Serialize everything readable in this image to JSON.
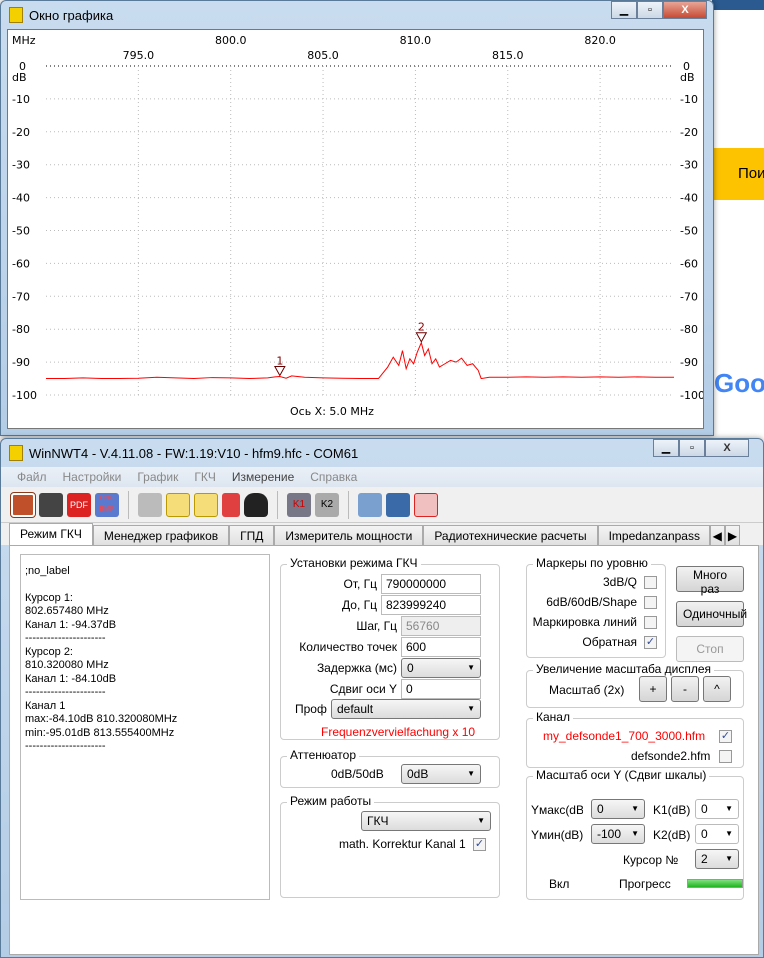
{
  "background": {
    "yellow_text": "Пои",
    "logo_text": "Goo"
  },
  "graph_window": {
    "title": "Окно графика",
    "x_unit": "MHz",
    "y_unit": "dB",
    "x_axis_label": "Ось X: 5.0 MHz",
    "chart_data": {
      "type": "line",
      "xlabel": "Ось X: 5.0 MHz",
      "ylabel": "dB",
      "xlim": [
        790,
        824
      ],
      "ylim": [
        -100,
        0
      ],
      "x_ticks_top": [
        "800.0",
        "810.0",
        "820.0"
      ],
      "x_ticks_bottom": [
        "795.0",
        "805.0",
        "815.0"
      ],
      "x_tick_values_top": [
        800,
        810,
        820
      ],
      "x_tick_values_bottom": [
        795,
        805,
        815
      ],
      "y_ticks": [
        "0",
        "-10",
        "-20",
        "-30",
        "-40",
        "-50",
        "-60",
        "-70",
        "-80",
        "-90",
        "-100"
      ],
      "y_tick_values": [
        0,
        -10,
        -20,
        -30,
        -40,
        -50,
        -60,
        -70,
        -80,
        -90,
        -100
      ],
      "grid": true,
      "series": [
        {
          "name": "Канал 1",
          "color": "#ff0000",
          "x": [
            790,
            791,
            792,
            793,
            794,
            795,
            796,
            797,
            798,
            799,
            800,
            801,
            802,
            802.4,
            802.66,
            803,
            803.3,
            804,
            805,
            806,
            807,
            808,
            808.5,
            808.8,
            809.1,
            809.3,
            809.5,
            809.7,
            809.9,
            810.1,
            810.32,
            810.5,
            810.7,
            810.9,
            811.1,
            811.3,
            811.6,
            811.9,
            812.2,
            812.5,
            812.8,
            813.1,
            813.4,
            813.56,
            814,
            815,
            816,
            817,
            818,
            819,
            820,
            821,
            822,
            823,
            824
          ],
          "y": [
            -95,
            -95,
            -94.8,
            -95,
            -95,
            -94.9,
            -94.6,
            -94.8,
            -95,
            -94.7,
            -94.8,
            -95,
            -94.8,
            -94.5,
            -94.37,
            -94.9,
            -94.2,
            -94.6,
            -94.8,
            -94.9,
            -95,
            -95,
            -91.5,
            -88.5,
            -91,
            -86.5,
            -92,
            -89,
            -90.5,
            -87,
            -84.1,
            -88,
            -86,
            -90.5,
            -89,
            -91.5,
            -90.5,
            -89.5,
            -90,
            -88.8,
            -91,
            -90.5,
            -92.5,
            -95.01,
            -94.6,
            -94.6,
            -94.5,
            -94.6,
            -94.5,
            -94.6,
            -94.5,
            -94.6,
            -94.5,
            -94.6,
            -94.6
          ]
        }
      ],
      "markers": [
        {
          "label": "1",
          "x": 802.66,
          "y": -94.37
        },
        {
          "label": "2",
          "x": 810.32,
          "y": -84.1
        }
      ]
    }
  },
  "main_window": {
    "title": "WinNWT4 - V.4.11.08 - FW:1.19:V10 - hfm9.hfc - COM61",
    "menu": [
      "Файл",
      "Настройки",
      "График",
      "ГКЧ",
      "Измерение",
      "Справка"
    ],
    "tabs": [
      "Режим ГКЧ",
      "Менеджер графиков",
      "ГПД",
      "Измеритель мощности",
      "Радиотехнические расчеты",
      "Impedanzanpass"
    ],
    "info_lines": [
      ";no_label",
      "",
      "Курсор 1:",
      "802.657480 MHz",
      "Канал 1:  -94.37dB",
      "----------------------",
      "Курсор 2:",
      "810.320080 MHz",
      "Канал 1:  -84.10dB",
      "----------------------",
      "Канал 1",
      "max:-84.10dB 810.320080MHz",
      "min:-95.01dB 813.555400MHz",
      "----------------------"
    ],
    "sweep": {
      "title": "Установки режима ГКЧ",
      "from_label": "От, Гц",
      "from": "790000000",
      "to_label": "До, Гц",
      "to": "823999240",
      "step_label": "Шаг, Гц",
      "step": "56760",
      "points_label": "Количество точек",
      "points": "600",
      "delay_label": "Задержка (мс)",
      "delay": "0",
      "yshift_label": "Сдвиг оси Y",
      "yshift": "0",
      "profile_label": "Проф",
      "profile": "default",
      "note": "Frequenzvervielfachung x 10",
      "note_color": "#ff0000"
    },
    "attenuator": {
      "title": "Аттенюатор",
      "label": "0dB/50dB",
      "value": "0dB"
    },
    "mode": {
      "title": "Режим работы",
      "value": "ГКЧ",
      "korr_label": "math. Korrektur Kanal 1",
      "korr_checked": true
    },
    "markers": {
      "title": "Маркеры по уровню",
      "items": [
        {
          "label": "3dB/Q",
          "checked": false
        },
        {
          "label": "6dB/60dB/Shape",
          "checked": false
        },
        {
          "label": "Маркировка линий",
          "checked": false
        },
        {
          "label": "Обратная",
          "checked": true
        }
      ]
    },
    "buttons": {
      "multi": "Много раз",
      "single": "Одиночный",
      "stop": "Стоп"
    },
    "zoom": {
      "title": "Увеличение масштаба дисплея",
      "label": "Масштаб (2x)",
      "plus": "+",
      "minus": "-",
      "up": "^"
    },
    "channel": {
      "title": "Канал",
      "file1": "my_defsonde1_700_3000.hfm",
      "file1_checked": true,
      "file2": "defsonde2.hfm",
      "file2_checked": false
    },
    "yscale": {
      "title": "Масштаб оси Y (Сдвиг шкалы)",
      "ymax_label": "Yмакс(dB",
      "ymax": "0",
      "ymin_label": "Yмин(dB)",
      "ymin": "-100",
      "k1_label": "K1(dB)",
      "k1": "0",
      "k2_label": "K2(dB)",
      "k2": "0",
      "cursor_label": "Курсор №",
      "cursor": "2",
      "on_label": "Вкл",
      "progress_label": "Прогресс",
      "progress": 1.0
    }
  }
}
